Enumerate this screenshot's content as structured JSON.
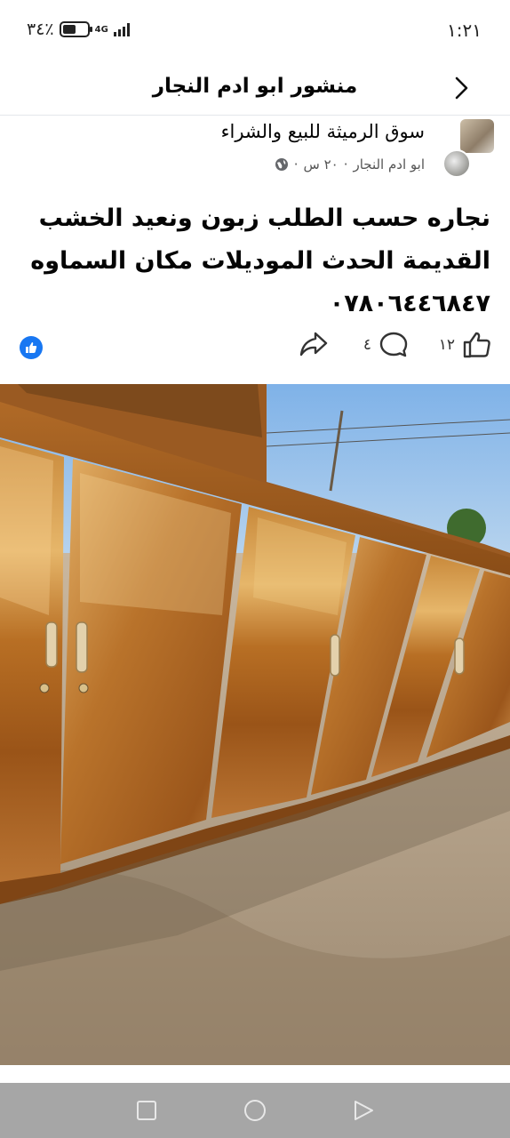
{
  "status_bar": {
    "time": "١:٢١",
    "battery_percent": "٣٤٪",
    "network": "4G",
    "battery_level": 0.34
  },
  "header": {
    "title": "منشور ابو ادم النجار",
    "back_icon": "chevron-right-icon"
  },
  "post": {
    "group_name": "سوق الرميثة للبيع والشراء",
    "author": "ابو ادم النجار",
    "time_ago": "٢٠ س",
    "privacy_icon": "globe-icon",
    "text_lines": [
      "نجاره حسب الطلب زبون ونعيد الخشب",
      "القديمة الحدث الموديلات مكان السماوه",
      "٠٧٨٠٦٤٤٦٨٤٧"
    ]
  },
  "reactions": {
    "like_count": "١٢",
    "comment_count": "٤",
    "reaction_badge_icon": "like-icon",
    "like_icon": "thumbs-up-icon",
    "comment_icon": "comment-icon",
    "share_icon": "share-icon"
  },
  "photo": {
    "subject": "wooden-wardrobe-photo"
  },
  "navbar": {
    "square_icon": "recent-apps-icon",
    "home_icon": "home-icon",
    "back_icon": "back-triangle-icon"
  }
}
